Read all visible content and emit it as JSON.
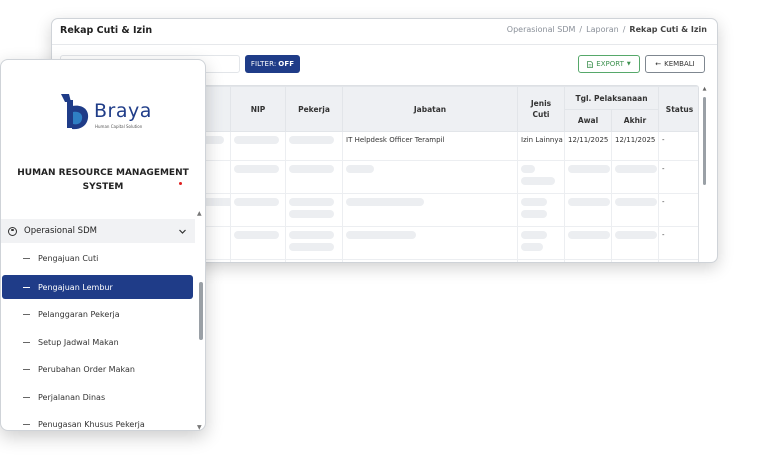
{
  "window": {
    "title": "Rekap Cuti & Izin",
    "breadcrumb": [
      "Operasional SDM",
      "Laporan",
      "Rekap Cuti & Izin"
    ],
    "filter_label": "FILTER:",
    "filter_value": "OFF",
    "export_label": "EXPORT",
    "back_label": "KEMBALI"
  },
  "table": {
    "headers": {
      "nip": "NIP",
      "pekerja": "Pekerja",
      "jabatan": "Jabatan",
      "jenis_cuti": "Jenis Cuti",
      "tgl": "Tgl. Pelaksanaan",
      "awal": "Awal",
      "akhir": "Akhir",
      "status": "Status"
    },
    "rows": [
      {
        "jabatan": "IT Helpdesk Officer Terampil",
        "jenis": "Izin Lainnya",
        "awal": "12/11/2025",
        "akhir": "12/11/2025",
        "status": "-"
      },
      {
        "status": "-"
      },
      {
        "status": "-"
      },
      {
        "status": "-"
      },
      {
        "status": "-"
      }
    ]
  },
  "sidebar": {
    "brand": "Braya",
    "brand_sub": "Human Capital Solution",
    "app_title_line1": "HUMAN RESOURCE MANAGEMENT",
    "app_title_line2": "SYSTEM",
    "section_label": "Operasional SDM",
    "items": [
      {
        "label": "Pengajuan Cuti"
      },
      {
        "label": "Pengajuan Lembur"
      },
      {
        "label": "Pelanggaran Pekerja"
      },
      {
        "label": "Setup Jadwal Makan"
      },
      {
        "label": "Perubahan Order Makan"
      },
      {
        "label": "Perjalanan Dinas"
      },
      {
        "label": "Penugasan Khusus Pekerja"
      }
    ],
    "active_index": 1
  },
  "colors": {
    "primary": "#1f3c88",
    "export_green": "#3e9150",
    "dot_red": "#e02020"
  }
}
